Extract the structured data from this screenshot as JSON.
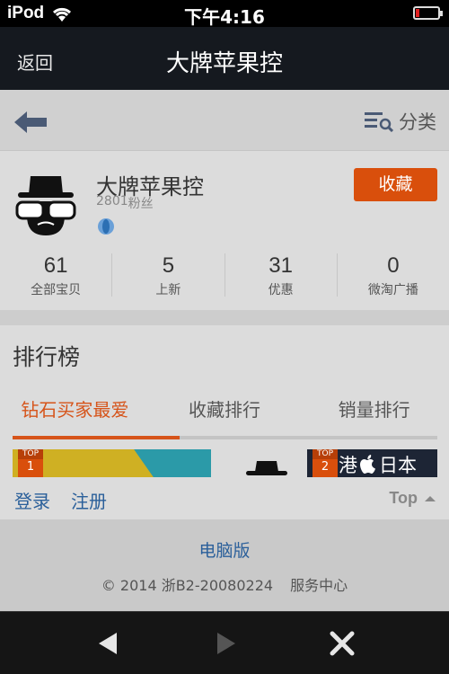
{
  "status_bar": {
    "carrier": "iPod",
    "time": "下午4:16"
  },
  "nav": {
    "back_label": "返回",
    "title": "大牌苹果控"
  },
  "toolbar": {
    "category_label": "分类"
  },
  "shop": {
    "name": "大牌苹果控",
    "fans_count": "2801",
    "fans_label": "粉丝",
    "favorite_label": "收藏",
    "stats": [
      {
        "value": "61",
        "label": "全部宝贝"
      },
      {
        "value": "5",
        "label": "上新"
      },
      {
        "value": "31",
        "label": "优惠"
      },
      {
        "value": "0",
        "label": "微淘广播"
      }
    ]
  },
  "ranking": {
    "heading": "排行榜",
    "tabs": [
      "钻石买家最爱",
      "收藏排行",
      "销量排行"
    ],
    "active_tab": 0,
    "banners": [
      {
        "flag": "TOP",
        "rank": "1"
      },
      {
        "flag": "TOP",
        "rank": "2",
        "text_before": "港",
        "text_after": "日本"
      }
    ]
  },
  "auth": {
    "login": "登录",
    "register": "注册",
    "top": "Top"
  },
  "footer": {
    "pc_version": "电脑版",
    "copyright": "© 2014 浙B2-20080224",
    "service": "服务中心"
  },
  "colors": {
    "accent": "#d94f0c",
    "link": "#2a5f9a",
    "nav_bg": "#15191f"
  }
}
